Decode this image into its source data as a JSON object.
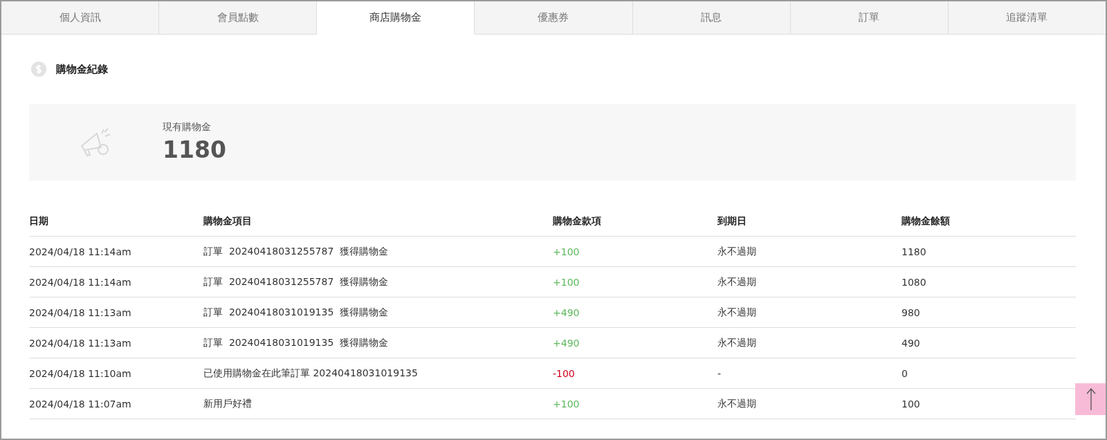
{
  "tabs": [
    {
      "label": "個人資訊",
      "selected": false
    },
    {
      "label": "會員點數",
      "selected": false
    },
    {
      "label": "商店購物金",
      "selected": true
    },
    {
      "label": "優惠券",
      "selected": false
    },
    {
      "label": "訊息",
      "selected": false
    },
    {
      "label": "訂單",
      "selected": false
    },
    {
      "label": "追蹤清單",
      "selected": false
    }
  ],
  "section_title": "購物金紀錄",
  "summary": {
    "label": "現有購物金",
    "value": "1180"
  },
  "table": {
    "columns": [
      "日期",
      "購物金項目",
      "購物金款項",
      "到期日",
      "購物金餘額"
    ],
    "rows": [
      {
        "date": "2024/04/18 11:14am",
        "item": "訂單  20240418031255787  獲得購物金",
        "amount": "+100",
        "color": "#5cb85c",
        "expiry": "永不過期",
        "balance": "1180"
      },
      {
        "date": "2024/04/18 11:14am",
        "item": "訂單  20240418031255787  獲得購物金",
        "amount": "+100",
        "color": "#5cb85c",
        "expiry": "永不過期",
        "balance": "1080"
      },
      {
        "date": "2024/04/18 11:13am",
        "item": "訂單  20240418031019135  獲得購物金",
        "amount": "+490",
        "color": "#5cb85c",
        "expiry": "永不過期",
        "balance": "980"
      },
      {
        "date": "2024/04/18 11:13am",
        "item": "訂單  20240418031019135  獲得購物金",
        "amount": "+490",
        "color": "#5cb85c",
        "expiry": "永不過期",
        "balance": "490"
      },
      {
        "date": "2024/04/18 11:10am",
        "item": "已使用購物金在此筆訂單 20240418031019135",
        "amount": "-100",
        "color": "#d0021b",
        "expiry": "-",
        "balance": "0"
      },
      {
        "date": "2024/04/18 11:07am",
        "item": "新用戶好禮",
        "amount": "+100",
        "color": "#5cb85c",
        "expiry": "永不過期",
        "balance": "100"
      }
    ]
  }
}
